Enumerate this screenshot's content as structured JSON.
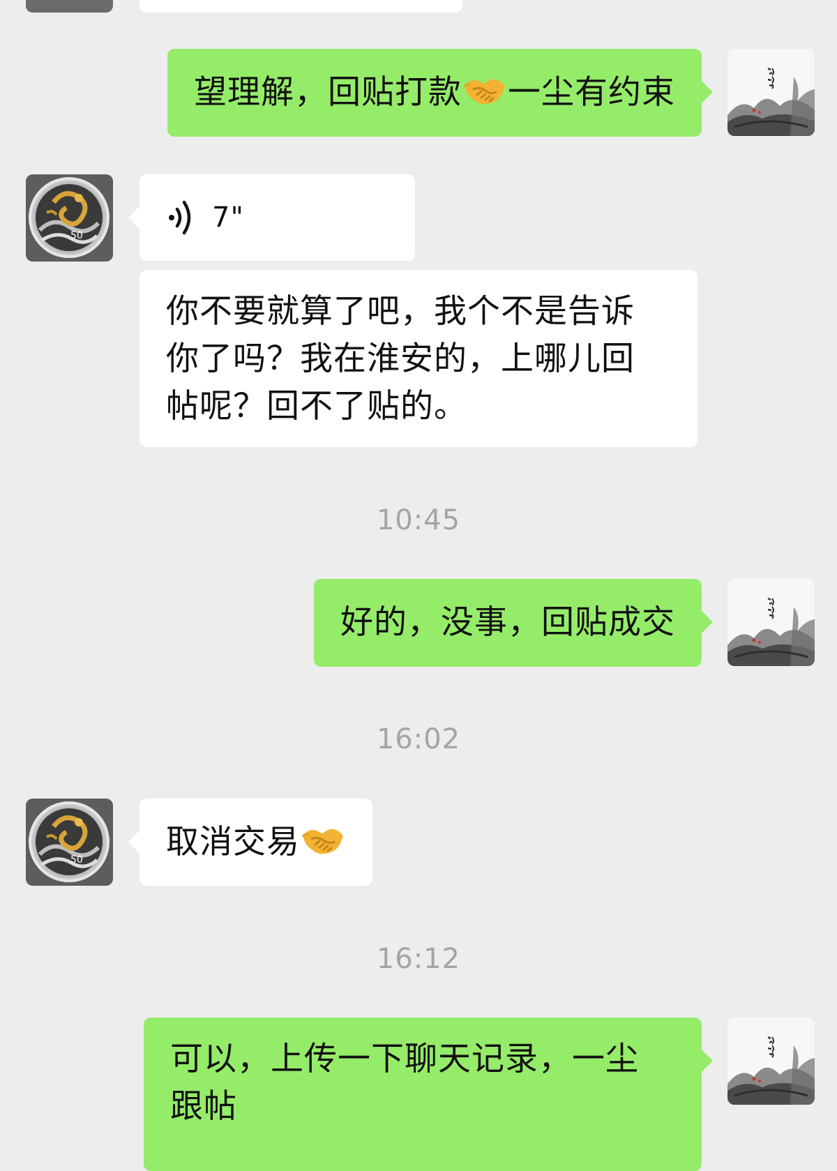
{
  "messages": {
    "m1": {
      "text": "望理解，回贴打款",
      "text2": "一尘有约束",
      "emoji": "handshake"
    },
    "m2": {
      "duration": "7\""
    },
    "m3": {
      "line1": "你不要就算了吧，我个不是告诉",
      "line2": "你了吗？我在淮安的，上哪儿回",
      "line3": "帖呢？回不了贴的。"
    },
    "m4": {
      "text": "好的，没事，回贴成交"
    },
    "m5": {
      "text": "取消交易",
      "emoji": "handshake"
    },
    "m6": {
      "line1": "可以，上传一下聊天记录，一尘",
      "line2": "跟帖"
    }
  },
  "timestamps": {
    "t1": "10:45",
    "t2": "16:02",
    "t3": "16:12"
  },
  "avatars": {
    "contact": "dragon-coin-avatar",
    "self": "ink-landscape-avatar"
  },
  "colors": {
    "background": "#ededed",
    "outgoing_bubble": "#95ec69",
    "incoming_bubble": "#ffffff",
    "timestamp": "#a4a4a4"
  }
}
